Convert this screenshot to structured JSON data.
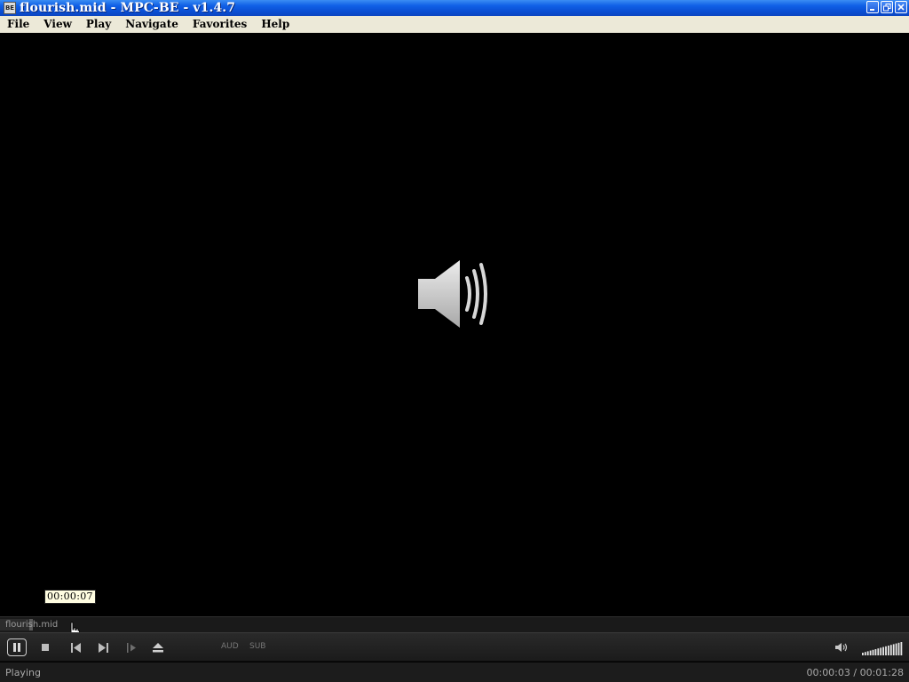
{
  "window": {
    "title": "flourish.mid - MPC-BE - v1.4.7",
    "app_icon": "mpc-be-icon",
    "app_icon_text": "BE",
    "buttons": [
      "minimize",
      "restore",
      "close"
    ]
  },
  "menu": {
    "items": [
      {
        "label": "File"
      },
      {
        "label": "View"
      },
      {
        "label": "Play"
      },
      {
        "label": "Navigate"
      },
      {
        "label": "Favorites"
      },
      {
        "label": "Help"
      }
    ]
  },
  "video": {
    "content_icon": "speaker-audio-icon",
    "seek_tooltip": "00:00:07"
  },
  "seekbar": {
    "filename": "flourish.mid",
    "position_seconds": 3,
    "duration_seconds": 88
  },
  "toolbar": {
    "buttons": [
      "pause",
      "stop",
      "previous",
      "next",
      "frame-step",
      "eject"
    ],
    "audio_label": "AUD",
    "subtitle_label": "SUB",
    "volume_level": 1.0
  },
  "status": {
    "state": "Playing",
    "time": "00:00:03 / 00:01:28"
  },
  "colors": {
    "titlebar": "#0a4fd4",
    "menubar": "#ece9d8",
    "video_bg": "#000000",
    "controls_bg": "#1b1b1b",
    "tooltip_bg": "#fffde1"
  }
}
